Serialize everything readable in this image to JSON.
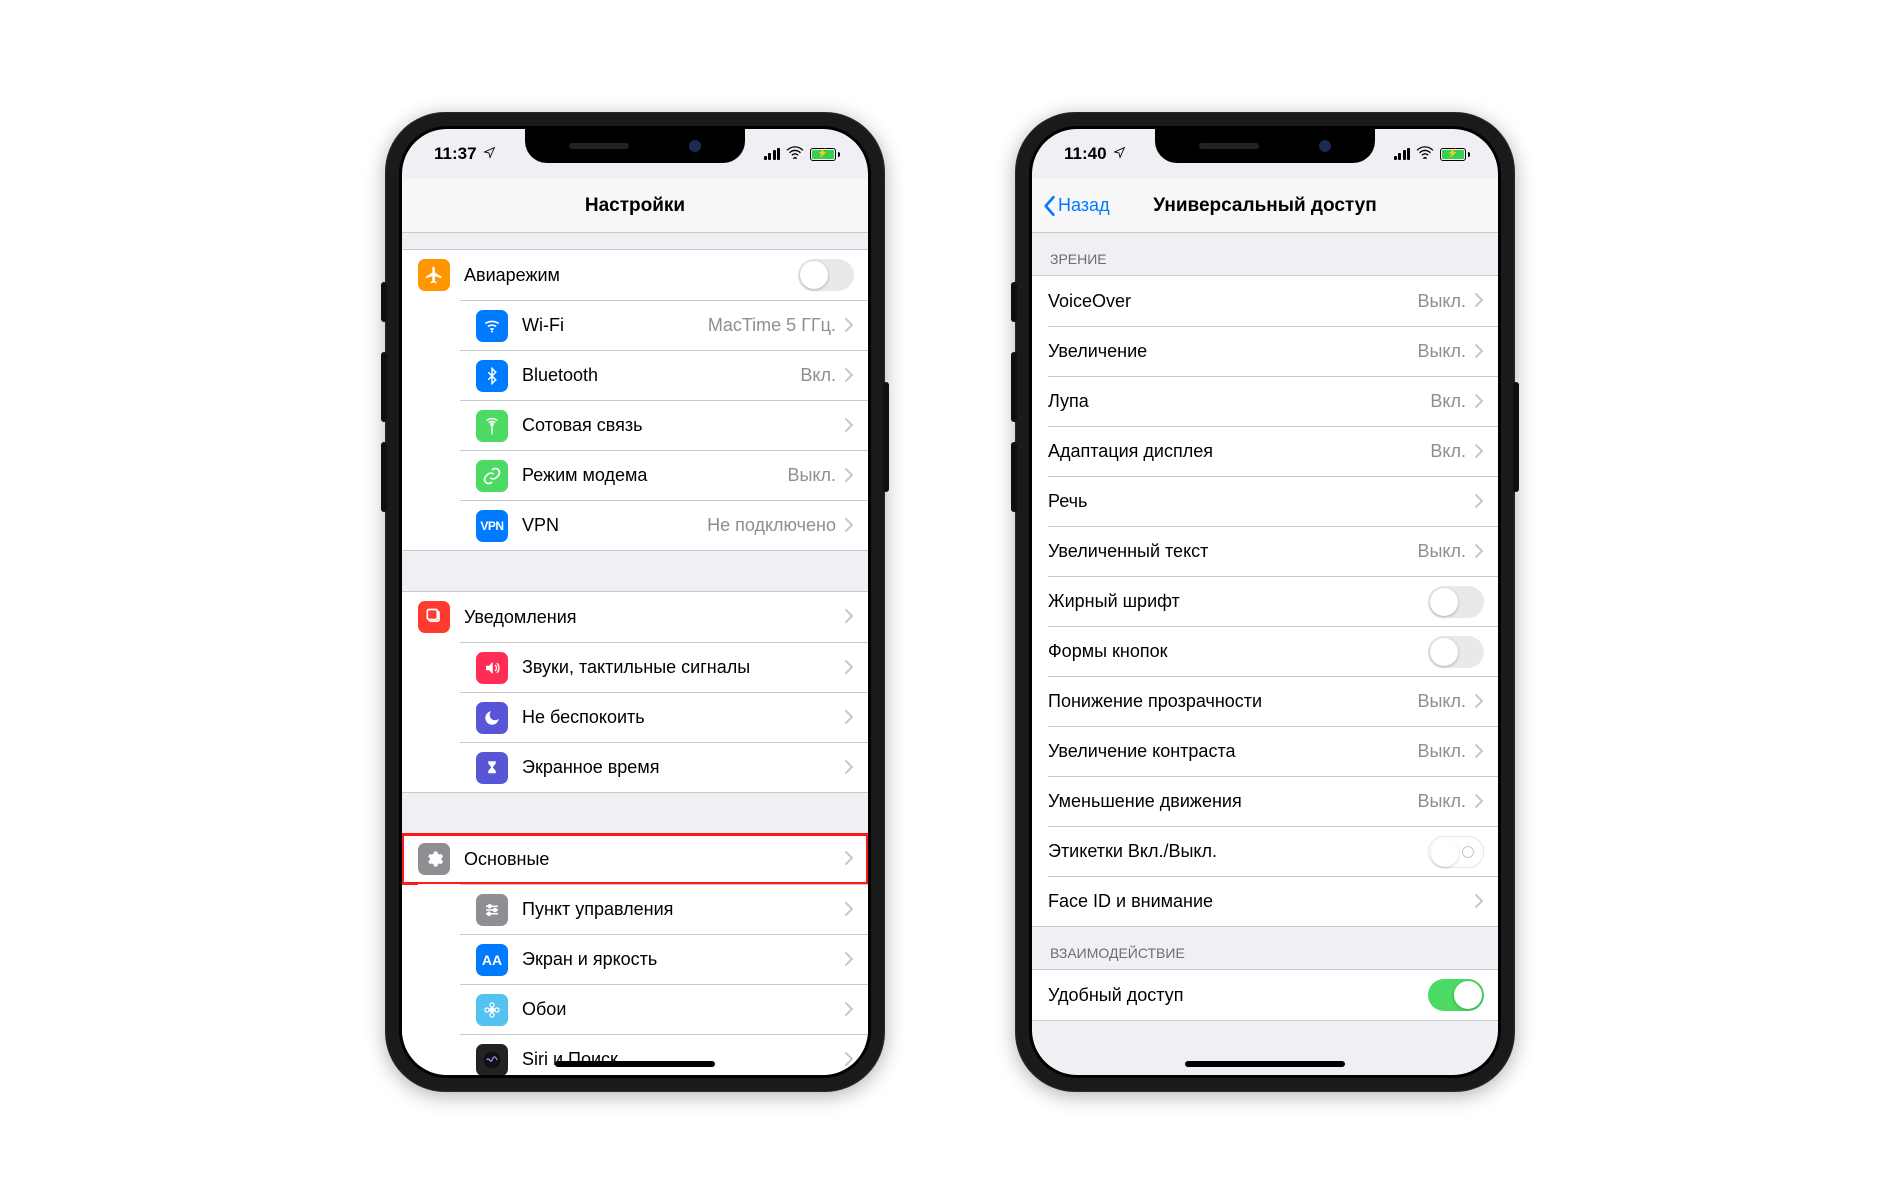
{
  "left": {
    "status": {
      "time": "11:37",
      "battery_charging": true
    },
    "title": "Настройки",
    "groups": [
      {
        "rows": [
          {
            "icon": "airplane",
            "color": "#ff9500",
            "label": "Авиарежим",
            "type": "switch",
            "on": false
          },
          {
            "icon": "wifi",
            "color": "#007aff",
            "label": "Wi-Fi",
            "value": "MacTime 5 ГГц.",
            "type": "disclose"
          },
          {
            "icon": "bluetooth",
            "color": "#007aff",
            "label": "Bluetooth",
            "value": "Вкл.",
            "type": "disclose"
          },
          {
            "icon": "antenna",
            "color": "#4cd964",
            "label": "Сотовая связь",
            "type": "disclose"
          },
          {
            "icon": "link",
            "color": "#4cd964",
            "label": "Режим модема",
            "value": "Выкл.",
            "type": "disclose"
          },
          {
            "icon": "vpn",
            "color": "#007aff",
            "label": "VPN",
            "value": "Не подключено",
            "type": "disclose"
          }
        ]
      },
      {
        "rows": [
          {
            "icon": "bell",
            "color": "#ff3b30",
            "label": "Уведомления",
            "type": "disclose"
          },
          {
            "icon": "speaker",
            "color": "#ff2d55",
            "label": "Звуки, тактильные сигналы",
            "type": "disclose"
          },
          {
            "icon": "moon",
            "color": "#5856d6",
            "label": "Не беспокоить",
            "type": "disclose"
          },
          {
            "icon": "hourglass",
            "color": "#5856d6",
            "label": "Экранное время",
            "type": "disclose"
          }
        ]
      },
      {
        "rows": [
          {
            "icon": "gear",
            "color": "#8e8e93",
            "label": "Основные",
            "type": "disclose",
            "highlight": true
          },
          {
            "icon": "sliders",
            "color": "#8e8e93",
            "label": "Пункт управления",
            "type": "disclose"
          },
          {
            "icon": "aa",
            "color": "#007aff",
            "label": "Экран и яркость",
            "type": "disclose"
          },
          {
            "icon": "flower",
            "color": "#53c2f0",
            "label": "Обои",
            "type": "disclose"
          },
          {
            "icon": "siri",
            "color": "#222",
            "label": "Siri и Поиск",
            "type": "disclose"
          }
        ]
      }
    ]
  },
  "right": {
    "status": {
      "time": "11:40",
      "battery_charging": true
    },
    "back": "Назад",
    "title": "Универсальный доступ",
    "sections": [
      {
        "header": "ЗРЕНИЕ",
        "rows": [
          {
            "label": "VoiceOver",
            "value": "Выкл.",
            "type": "disclose"
          },
          {
            "label": "Увеличение",
            "value": "Выкл.",
            "type": "disclose"
          },
          {
            "label": "Лупа",
            "value": "Вкл.",
            "type": "disclose"
          },
          {
            "label": "Адаптация дисплея",
            "value": "Вкл.",
            "type": "disclose"
          },
          {
            "label": "Речь",
            "type": "disclose"
          },
          {
            "label": "Увеличенный текст",
            "value": "Выкл.",
            "type": "disclose"
          },
          {
            "label": "Жирный шрифт",
            "type": "switch",
            "on": false
          },
          {
            "label": "Формы кнопок",
            "type": "switch",
            "on": false
          },
          {
            "label": "Понижение прозрачности",
            "value": "Выкл.",
            "type": "disclose"
          },
          {
            "label": "Увеличение контраста",
            "value": "Выкл.",
            "type": "disclose"
          },
          {
            "label": "Уменьшение движения",
            "value": "Выкл.",
            "type": "disclose"
          },
          {
            "label": "Этикетки Вкл./Выкл.",
            "type": "switch-io",
            "on": false
          },
          {
            "label": "Face ID и внимание",
            "type": "disclose"
          }
        ]
      },
      {
        "header": "ВЗАИМОДЕЙСТВИЕ",
        "rows": [
          {
            "label": "Удобный доступ",
            "type": "switch",
            "on": true
          }
        ]
      }
    ]
  }
}
